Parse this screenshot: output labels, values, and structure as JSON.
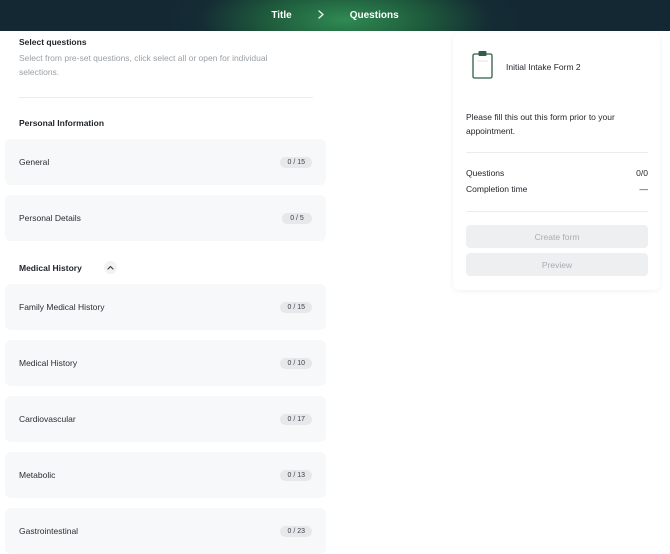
{
  "header": {
    "breadcrumb": [
      {
        "label": "Title"
      },
      {
        "label": "Questions"
      }
    ],
    "separator_icon": "chevron-right-icon"
  },
  "select": {
    "title": "Select questions",
    "description": "Select from pre-set questions, click select all or open for individual selections."
  },
  "sections": [
    {
      "title": "Personal Information",
      "cards": [
        {
          "label": "General",
          "count": "0 / 15"
        },
        {
          "label": "Personal Details",
          "count": "0 / 5"
        }
      ]
    },
    {
      "title": "Medical History",
      "toggle_icon": "chevron-up-icon",
      "cards": [
        {
          "label": "Family Medical History",
          "count": "0 / 15"
        },
        {
          "label": "Medical History",
          "count": "0 / 10"
        },
        {
          "label": "Cardiovascular",
          "count": "0 / 17"
        },
        {
          "label": "Metabolic",
          "count": "0 / 13"
        },
        {
          "label": "Gastrointestinal",
          "count": "0 / 23"
        }
      ]
    }
  ],
  "panel": {
    "form_icon": "clipboard-icon",
    "form_name": "Initial Intake Form 2",
    "description": "Please fill this out this form prior to your appointment.",
    "stats": [
      {
        "label": "Questions",
        "value": "0/0"
      },
      {
        "label": "Completion time",
        "value": "—"
      }
    ],
    "create_label": "Create form",
    "preview_label": "Preview"
  },
  "colors": {
    "header_green": "#2f8a52",
    "header_dark": "#142833",
    "card_bg": "#f7f8f9",
    "disabled_button": "#eeeff0"
  }
}
